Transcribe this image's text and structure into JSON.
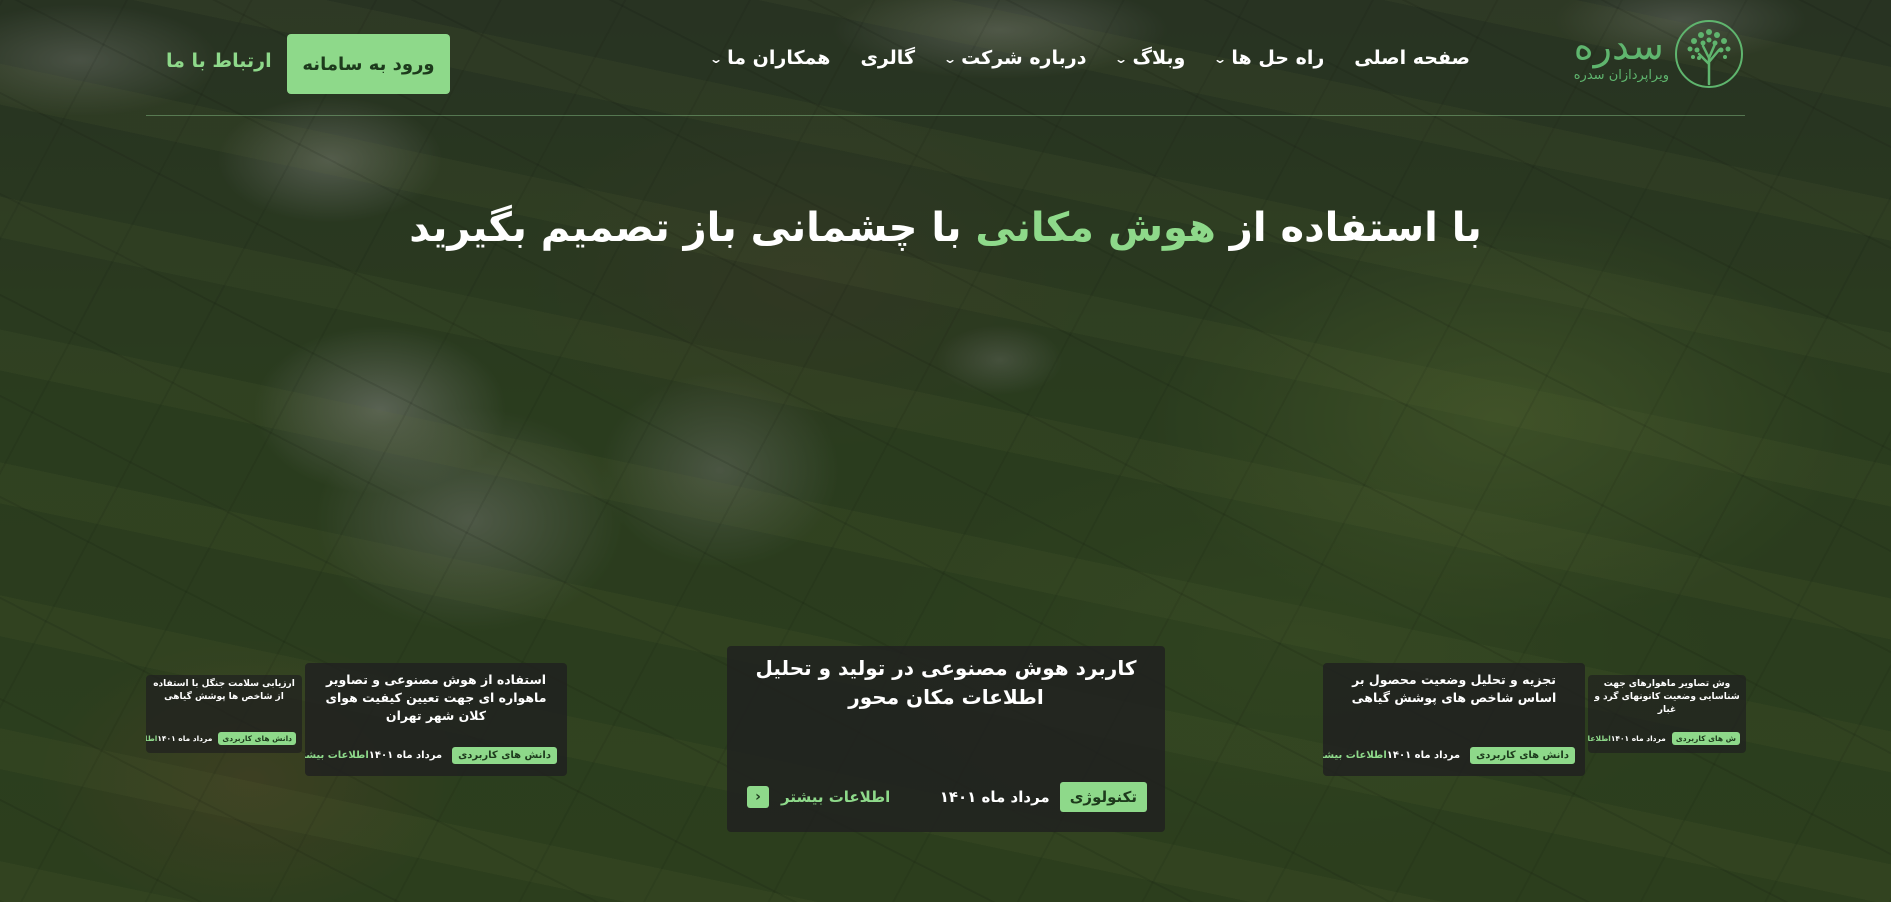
{
  "header": {
    "logo": {
      "name": "سدره",
      "subtitle": "ویراپردازان سدره"
    },
    "nav": [
      {
        "label": "صفحه اصلی",
        "has_dropdown": false
      },
      {
        "label": "راه حل ها",
        "has_dropdown": true
      },
      {
        "label": "وبلاگ",
        "has_dropdown": true
      },
      {
        "label": "درباره شرکت",
        "has_dropdown": true
      },
      {
        "label": "گالری",
        "has_dropdown": false
      },
      {
        "label": "همکاران ما",
        "has_dropdown": true
      }
    ],
    "login_label": "ورود به سامانه",
    "contact_label": "ارتباط با ما"
  },
  "hero": {
    "title_before": "با استفاده از ",
    "title_accent": "هوش مکانی",
    "title_after": " با چشمانی باز تصمیم بگیرید"
  },
  "cards": {
    "main": {
      "title": "کاربرد هوش مصنوعی در تولید و تحلیل اطلاعات مکان محور",
      "tag": "تکنولوژی",
      "date": "مرداد ماه ۱۴۰۱",
      "more": "اطلاعات بیشتر"
    },
    "left": {
      "title": "استفاده از هوش مصنوعی و تصاویر ماهواره ای جهت تعیین کیفیت هوای کلان شهر تهران",
      "tag": "دانش های کاربردی",
      "date": "مرداد ماه ۱۴۰۱",
      "more": "اطلاعات بیشتر"
    },
    "right": {
      "title": "تجزیه و تحلیل وضعیت محصول بر اساس شاخص های پوشش گیاهی",
      "tag": "دانش های کاربردی",
      "date": "مرداد ماه ۱۴۰۱",
      "more": "اطلاعات بیشتر"
    },
    "far_left": {
      "title": "ارزیابی سلامت جنگل با استفاده از شاخص ها پوشش گیاهی",
      "tag": "دانش های کاربردی",
      "date": "مرداد ماه ۱۴۰۱",
      "more": "اطلاعات بیشتر"
    },
    "far_right": {
      "title": "وش تصاویر ماهوارهای جهت شناسایی وضعیت کانونهای گرد و غبار",
      "tag": "ش های کاربردی",
      "date": "مرداد ماه ۱۴۰۱",
      "more": "اطلاعات بیشتر"
    }
  },
  "colors": {
    "accent": "#8ed98a",
    "logo_green": "#5fb56e",
    "card_bg": "#202020"
  },
  "icons": {
    "logo": "tree-icon",
    "dropdown": "chevron-down-icon",
    "card_arrow": "chevron-left-icon"
  }
}
